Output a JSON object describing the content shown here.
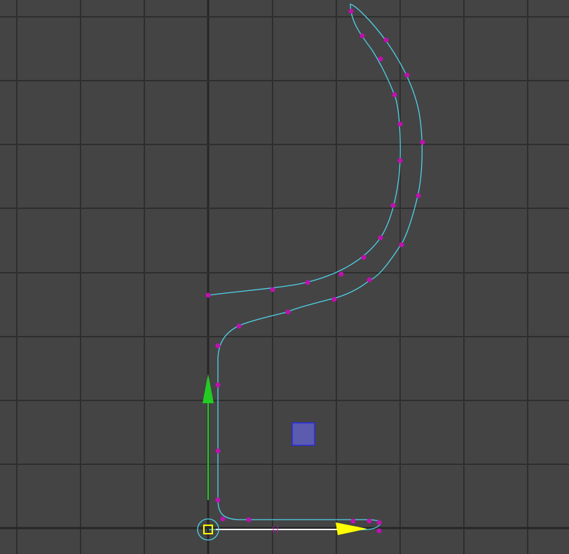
{
  "viewport": {
    "background_color": "#444444",
    "grid_color": "#2e2e2e",
    "axis_color": "#262626"
  },
  "curve": {
    "color": "#4fd2ea",
    "cv_color": "#c010b0"
  },
  "manipulator": {
    "y_axis_color": "#22cc22",
    "x_axis_color": "#ffff00",
    "handle_color": "#ffff00",
    "pivot_ring_color": "#4fd2ea",
    "proxy_square_color": "#5b5bb0",
    "proxy_square_border": "#2a2ae0",
    "icons": [
      "translate-y-arrow-icon",
      "translate-x-arrow-icon",
      "pivot-icon",
      "center-square-icon"
    ]
  }
}
